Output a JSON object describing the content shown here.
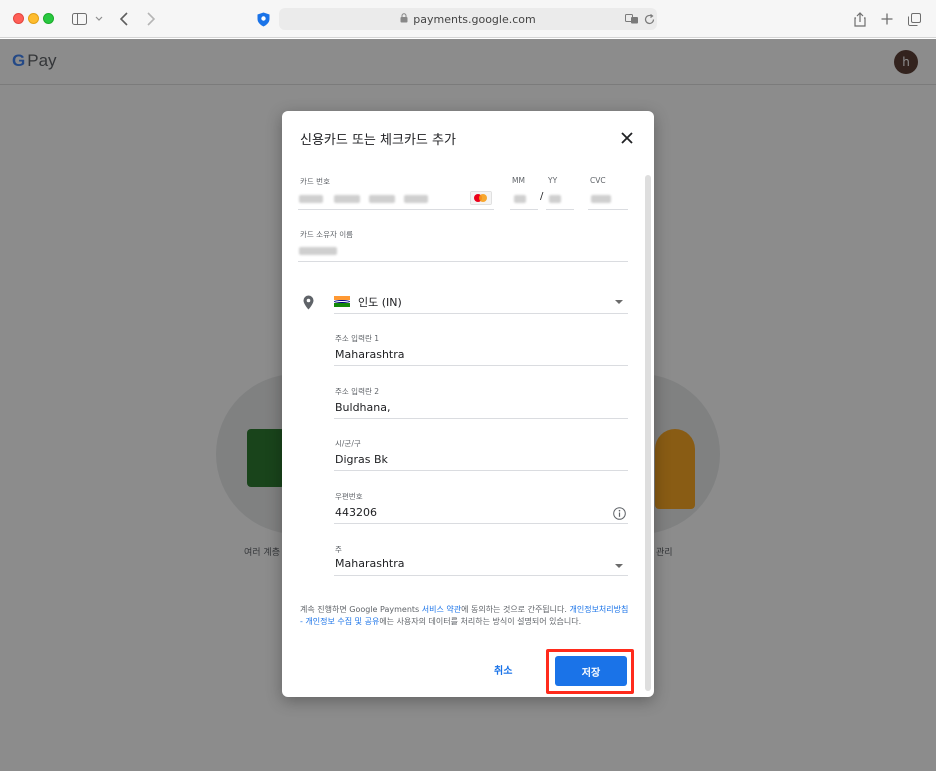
{
  "browser": {
    "url": "payments.google.com"
  },
  "app": {
    "logo_g": "G",
    "logo_text": "Pay",
    "avatar_initial": "h",
    "bg_caption_left": "여러 계층",
    "bg_caption_right": "관리"
  },
  "modal": {
    "title": "신용카드 또는 체크카드 추가",
    "card_number_label": "카드 번호",
    "mm_label": "MM",
    "yy_label": "YY",
    "cvc_label": "CVC",
    "expiry_separator": "/",
    "holder_label": "카드 소유자 이름",
    "country_value": "인도 (IN)",
    "address1_label": "주소 입력란 1",
    "address1_value": "Maharashtra",
    "address2_label": "주소 입력란 2",
    "address2_value": "Buldhana,",
    "city_label": "시/군/구",
    "city_value": "Digras Bk",
    "postal_label": "우편번호",
    "postal_value": "443206",
    "state_label": "주",
    "state_value": "Maharashtra",
    "terms_part1": "계속 진행하면 Google Payments ",
    "terms_link1": "서비스 약관",
    "terms_part2": "에 동의하는 것으로 간주됩니다. ",
    "terms_link2": "개인정보처리방침 - 개인정보 수집 및 공유",
    "terms_part3": "에는 사용자의 데이터를 처리하는 방식이 설명되어 있습니다.",
    "cancel_label": "취소",
    "save_label": "저장"
  },
  "colors": {
    "accent": "#1a73e8",
    "highlight": "#ff2b1c"
  },
  "icons": [
    "sidebar-icon",
    "chevron-down-icon",
    "back-icon",
    "forward-icon",
    "shield-icon",
    "lock-icon",
    "translate-icon",
    "reload-icon",
    "share-icon",
    "plus-icon",
    "tabs-icon",
    "close-icon",
    "mastercard-icon",
    "location-pin-icon",
    "india-flag-icon",
    "info-icon"
  ]
}
